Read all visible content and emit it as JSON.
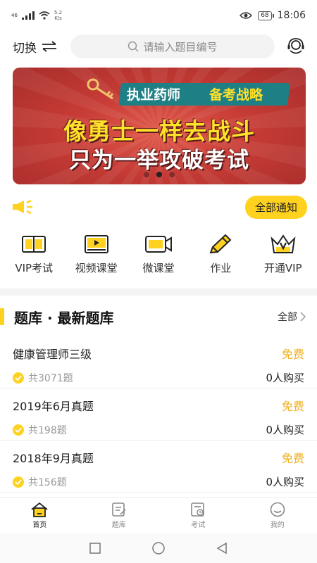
{
  "status_bar": {
    "signal": "46",
    "net_speed_value": "5.2",
    "net_speed_unit": "K/s",
    "battery": "68",
    "time": "18:06"
  },
  "header": {
    "switch_label": "切换",
    "search_placeholder": "请输入题目编号"
  },
  "banner": {
    "tag_part1": "执业药师",
    "tag_part2": "备考战略",
    "line1": "像勇士一样去战斗",
    "line2": "只为一举攻破考试",
    "slide_count": 3,
    "active_slide": 2
  },
  "notice": {
    "button_label": "全部通知"
  },
  "quick_nav": [
    {
      "label": "VIP考试",
      "icon": "book-icon"
    },
    {
      "label": "视频课堂",
      "icon": "video-player-icon"
    },
    {
      "label": "微课堂",
      "icon": "camera-icon"
    },
    {
      "label": "作业",
      "icon": "pencil-icon"
    },
    {
      "label": "开通VIP",
      "icon": "crown-icon"
    }
  ],
  "section": {
    "title": "题库 · 最新题库",
    "more_label": "全部"
  },
  "question_banks": [
    {
      "name": "健康管理师三级",
      "price": "免费",
      "count": "共3071题",
      "buyers": "0人购买"
    },
    {
      "name": "2019年6月真题",
      "price": "免费",
      "count": "共198题",
      "buyers": "0人购买"
    },
    {
      "name": "2018年9月真题",
      "price": "免费",
      "count": "共156题",
      "buyers": "0人购买"
    }
  ],
  "tabs": [
    {
      "label": "首页",
      "icon": "home-icon",
      "active": true
    },
    {
      "label": "题库",
      "icon": "question-bank-icon",
      "active": false
    },
    {
      "label": "考试",
      "icon": "exam-icon",
      "active": false
    },
    {
      "label": "我的",
      "icon": "profile-icon",
      "active": false
    }
  ],
  "colors": {
    "accent": "#ffd21f",
    "price": "#f2b01e",
    "banner_red": "#c63b35"
  }
}
